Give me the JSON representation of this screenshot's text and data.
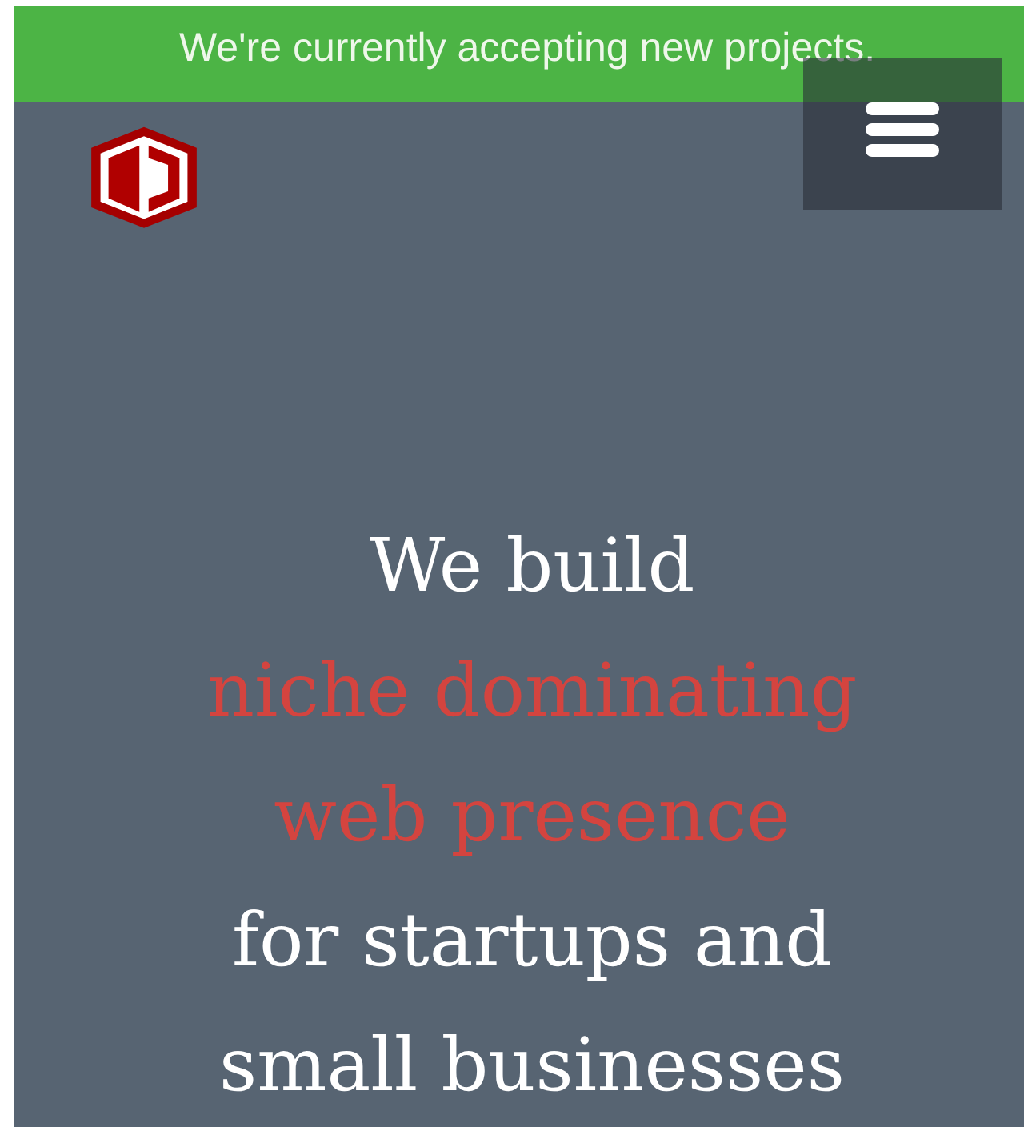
{
  "banner": {
    "text": "We're currently accepting new projects."
  },
  "hero": {
    "parts": [
      {
        "text": "We build",
        "kind": "plain"
      },
      {
        "text": "niche dominating web presence",
        "kind": "accent"
      },
      {
        "text": "for startups and small businesses",
        "kind": "plain"
      }
    ]
  }
}
